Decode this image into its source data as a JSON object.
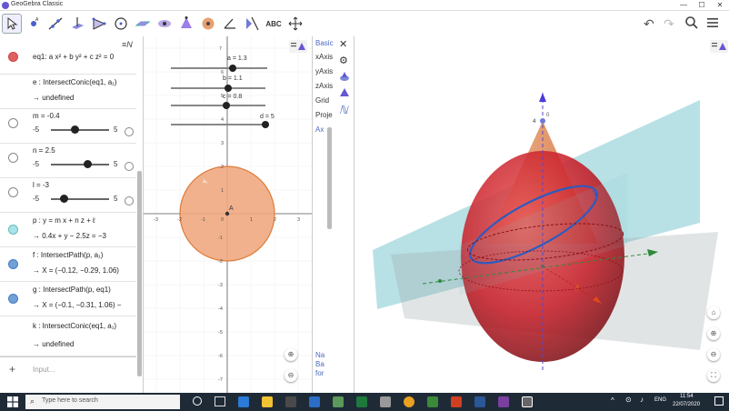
{
  "window": {
    "title": "GeoGebra Classic",
    "minimize": "—",
    "maximize": "☐",
    "close": "✕"
  },
  "toolbar": {
    "tools": [
      "move-tool",
      "point-tool",
      "line-tool",
      "perpendicular-tool",
      "polygon-tool",
      "circle-tool",
      "plane-tool",
      "pyramid-tool",
      "cone-tool",
      "sphere-tool",
      "angle-tool",
      "reflect-tool",
      "text-tool",
      "move-view-tool"
    ],
    "text_tool_label": "ABC"
  },
  "algebra": {
    "rows": [
      {
        "text": "eq1: a x² + b y² + c z² = 0",
        "marble": "#e06060"
      },
      {
        "text": "e : IntersectConic(eq1, a₁)",
        "result": "→  undefined"
      },
      {
        "text": "m = -0.4",
        "min": "-5",
        "max": "5",
        "value": -0.4
      },
      {
        "text": "n = 2.5",
        "min": "-5",
        "max": "5",
        "value": 2.5
      },
      {
        "text": "l = -3",
        "min": "-5",
        "max": "5",
        "value": -3
      },
      {
        "text": "p : y = m x + n z + ℓ",
        "result": "→  0.4x + y − 2.5z = −3",
        "marble": "#a8e4e8"
      },
      {
        "text": "f : IntersectPath(p, a₁)",
        "result": "→  X = (−0.12, −0.29, 1.06)",
        "marble": "#6fa0d8"
      },
      {
        "text": "g : IntersectPath(p, eq1)",
        "result": "→  X = (−0.1, −0.31, 1.06) −",
        "marble": "#6fa0d8"
      },
      {
        "text": "k : IntersectConic(eq1, a₁)",
        "result": "→  undefined"
      }
    ],
    "input_placeholder": "Input...",
    "add_symbol": "+"
  },
  "graphics2d": {
    "sliders": [
      {
        "label": "a = 1.3",
        "value": 1.3
      },
      {
        "label": "b = 1.1",
        "value": 1.1
      },
      {
        "label": "c = 0.8",
        "value": 0.8
      },
      {
        "label": "d = 5",
        "value": 5
      }
    ],
    "point_label": "A",
    "circle_label": "a₁",
    "x_ticks": [
      "-3",
      "-2",
      "-1",
      "0",
      "1",
      "2",
      "3"
    ],
    "y_ticks": [
      "7",
      "6",
      "5",
      "4",
      "3",
      "2",
      "1",
      "-1",
      "-2",
      "-3",
      "-4",
      "-5",
      "-6",
      "-7"
    ]
  },
  "properties": {
    "items": [
      "Basic",
      "xAxis",
      "yAxis",
      "zAxis",
      "Grid",
      "Proje",
      "Ax"
    ],
    "footer": [
      "Na",
      "Ba",
      "for"
    ]
  },
  "view3d": {
    "z_tick": "4",
    "z_tick_label": "0",
    "plane_label": "p",
    "conic_label": "e"
  },
  "taskbar": {
    "search_placeholder": "Type here to search",
    "lang": "ENG",
    "time": "11:54",
    "date": "22/07/2020"
  },
  "colors": {
    "circle_fill": "#f0a880",
    "circle_stroke": "#e07b39",
    "sphere": "#c8202a",
    "cone": "#e08050",
    "plane": "#7ec8d0",
    "accent": "#6557d2"
  }
}
